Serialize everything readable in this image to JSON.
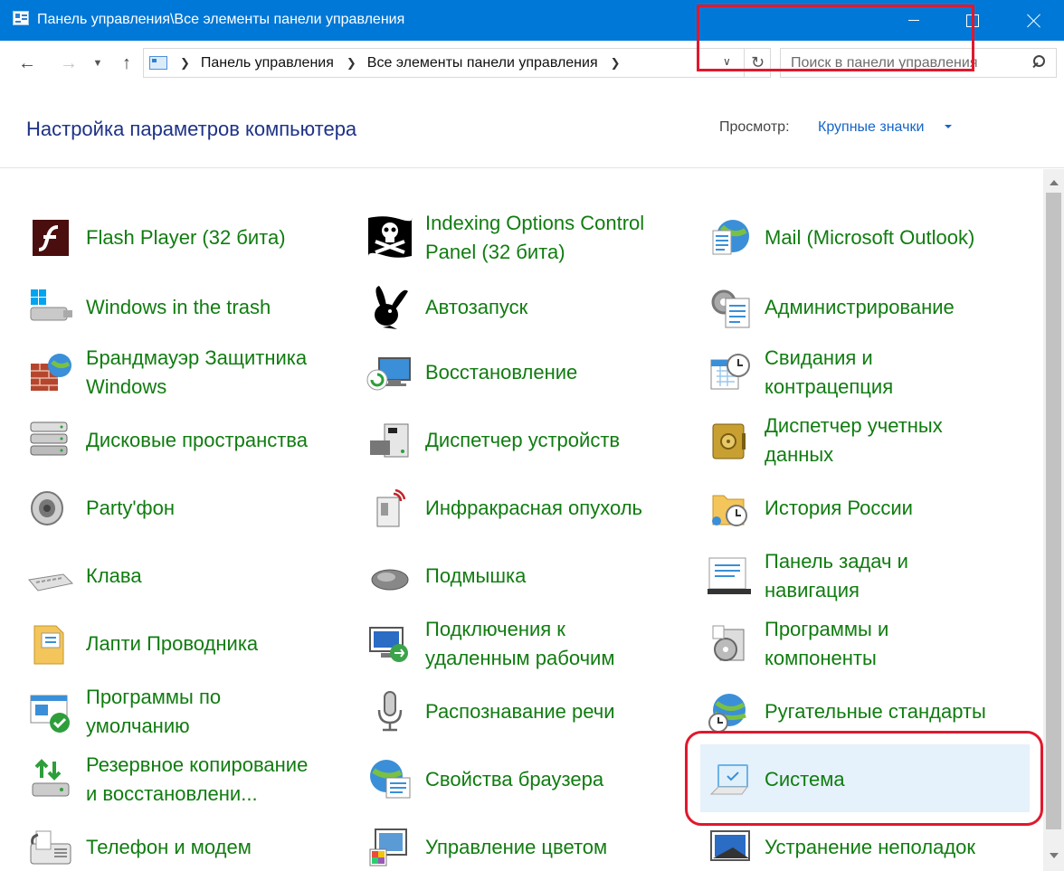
{
  "window": {
    "title": "Панель управления\\Все элементы панели управления"
  },
  "nav": {
    "back_glyph": "←",
    "forward_glyph": "→",
    "history_glyph": "⌄",
    "up_glyph": "↑",
    "breadcrumb": [
      "Панель управления",
      "Все элементы панели управления"
    ],
    "search_placeholder": "Поиск в панели управления"
  },
  "header": {
    "title": "Настройка параметров компьютера",
    "view_label": "Просмотр:",
    "view_value": "Крупные значки"
  },
  "items": [
    {
      "label_lines": [
        "Flash Player (32 бита)"
      ],
      "icon": "flash-icon"
    },
    {
      "label_lines": [
        "Indexing Options Control",
        "Panel (32 бита)"
      ],
      "icon": "pirate-flag-icon"
    },
    {
      "label_lines": [
        "Mail (Microsoft Outlook)"
      ],
      "icon": "mail-icon"
    },
    {
      "label_lines": [
        "Windows in the trash"
      ],
      "icon": "usb-drive-icon"
    },
    {
      "label_lines": [
        "Автозапуск"
      ],
      "icon": "bunny-logo-icon"
    },
    {
      "label_lines": [
        "Администрирование"
      ],
      "icon": "admin-tools-icon"
    },
    {
      "label_lines": [
        "Брандмауэр Защитника",
        "Windows"
      ],
      "icon": "firewall-icon"
    },
    {
      "label_lines": [
        "Восстановление"
      ],
      "icon": "recovery-icon"
    },
    {
      "label_lines": [
        "Свидания и",
        "контрацепция"
      ],
      "icon": "calendar-clock-icon"
    },
    {
      "label_lines": [
        "Дисковые пространства"
      ],
      "icon": "disk-stack-icon"
    },
    {
      "label_lines": [
        "Диспетчер устройств"
      ],
      "icon": "device-manager-icon"
    },
    {
      "label_lines": [
        "Диспетчер учетных",
        "данных"
      ],
      "icon": "credential-safe-icon"
    },
    {
      "label_lines": [
        "Party'фон"
      ],
      "icon": "speaker-icon"
    },
    {
      "label_lines": [
        "Инфракрасная  опухоль"
      ],
      "icon": "infrared-icon"
    },
    {
      "label_lines": [
        "История России"
      ],
      "icon": "folder-clock-icon"
    },
    {
      "label_lines": [
        "Клава"
      ],
      "icon": "keyboard-icon"
    },
    {
      "label_lines": [
        "Подмышка"
      ],
      "icon": "mouse-icon"
    },
    {
      "label_lines": [
        "Панель задач и",
        "навигация"
      ],
      "icon": "taskbar-icon"
    },
    {
      "label_lines": [
        "Лапти Проводника"
      ],
      "icon": "explorer-options-icon"
    },
    {
      "label_lines": [
        "Подключения к",
        "удаленным рабочим"
      ],
      "icon": "remote-desktop-icon"
    },
    {
      "label_lines": [
        "Программы и",
        "компоненты"
      ],
      "icon": "programs-icon"
    },
    {
      "label_lines": [
        "Программы по",
        "умолчанию"
      ],
      "icon": "default-programs-icon"
    },
    {
      "label_lines": [
        "Распознавание речи"
      ],
      "icon": "microphone-icon"
    },
    {
      "label_lines": [
        "Ругательные стандарты"
      ],
      "icon": "globe-clock-icon"
    },
    {
      "label_lines": [
        "Резервное копирование",
        "и восстановлени..."
      ],
      "icon": "backup-icon"
    },
    {
      "label_lines": [
        "Свойства браузера"
      ],
      "icon": "globe-list-icon"
    },
    {
      "label_lines": [
        "Система"
      ],
      "icon": "laptop-check-icon"
    },
    {
      "label_lines": [
        "Телефон и модем"
      ],
      "icon": "fax-icon"
    },
    {
      "label_lines": [
        "Управление цветом"
      ],
      "icon": "color-management-icon"
    },
    {
      "label_lines": [
        "Устранение неполадок"
      ],
      "icon": "troubleshoot-icon"
    }
  ],
  "colors": {
    "titlebar": "#0078d7",
    "link_green": "#107c10",
    "heading_blue": "#1e3287",
    "annotation_red": "#e0182d",
    "selection": "#e5f1fb"
  }
}
